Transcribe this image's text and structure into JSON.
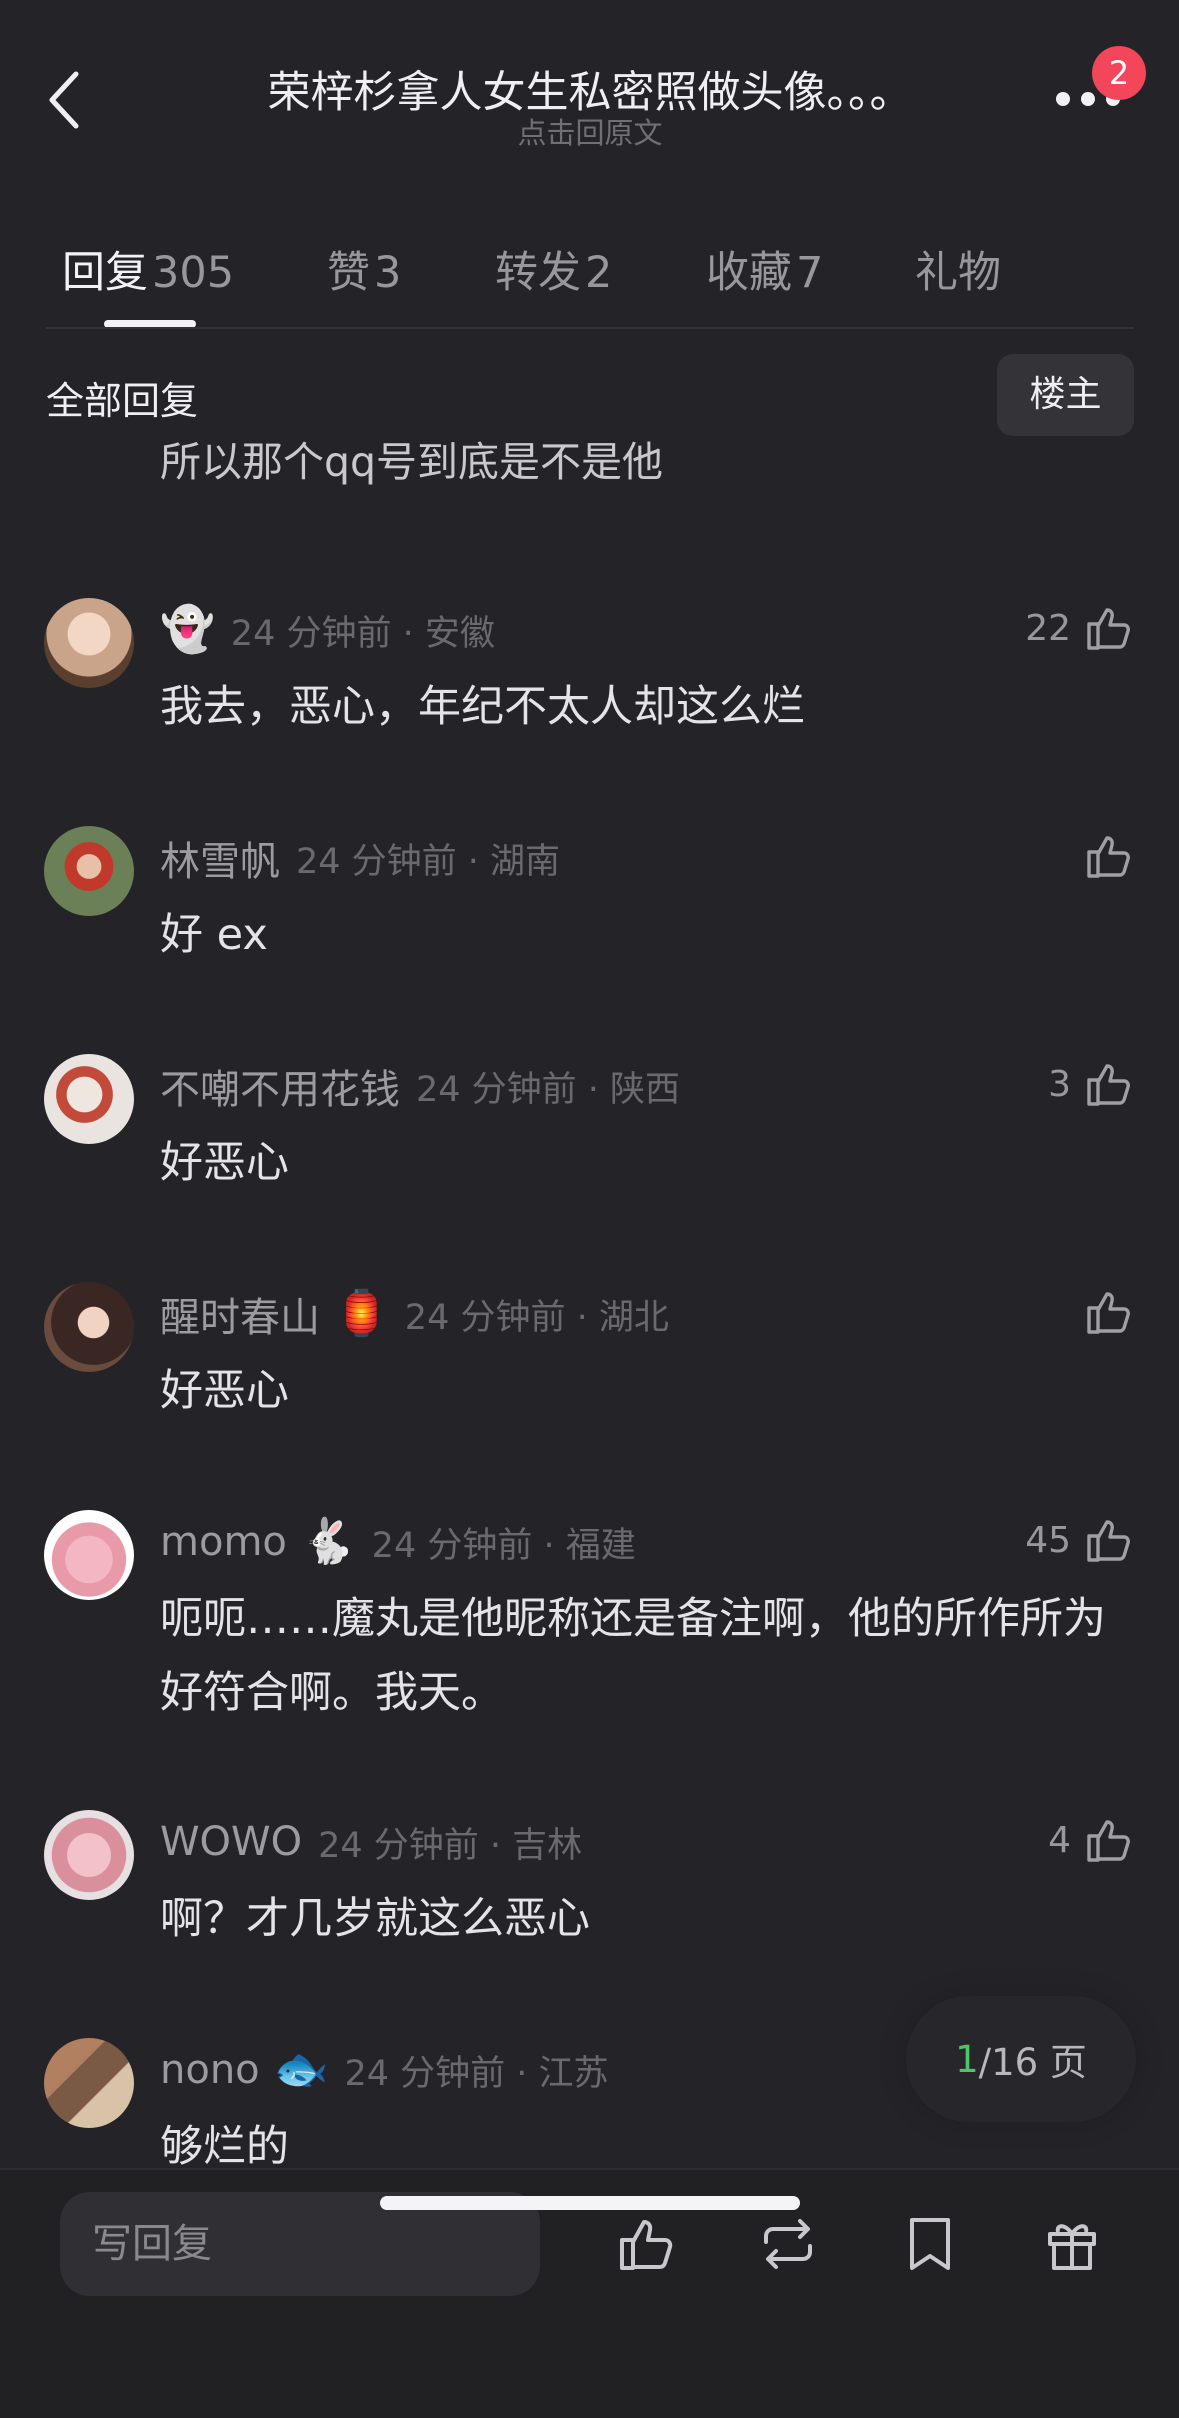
{
  "header": {
    "title": "荣梓杉拿人女生私密照做头像。。。",
    "subtitle": "点击回原文",
    "badge": "2"
  },
  "tabs": [
    {
      "label": "回复",
      "count": "305"
    },
    {
      "label": "赞",
      "count": "3"
    },
    {
      "label": "转发",
      "count": "2"
    },
    {
      "label": "收藏",
      "count": "7"
    },
    {
      "label": "礼物",
      "count": ""
    }
  ],
  "section": {
    "title": "全部回复",
    "owner_button": "楼主"
  },
  "cutoff_text": "所以那个qq号到底是不是他",
  "comments": [
    {
      "user": "",
      "emoji": "👻",
      "time": "24 分钟前 · 安徽",
      "likes": "22",
      "text": "我去，恶心，年纪不太人却这么烂",
      "avatar_color": "#c9a38a"
    },
    {
      "user": "林雪帆",
      "emoji": "",
      "time": "24 分钟前 · 湖南",
      "likes": "",
      "text": "好 ex",
      "avatar_color": "#5b6b4a"
    },
    {
      "user": "不嘲不用花钱",
      "emoji": "",
      "time": "24 分钟前 · 陕西",
      "likes": "3",
      "text": "好恶心",
      "avatar_color": "#d8d2cc"
    },
    {
      "user": "醒时春山",
      "emoji": "🏮",
      "time": "24 分钟前 · 湖北",
      "likes": "",
      "text": "好恶心",
      "avatar_color": "#4a3a36"
    },
    {
      "user": "momo",
      "emoji": "🐇",
      "time": "24 分钟前 · 福建",
      "likes": "45",
      "text": "呃呃……魔丸是他昵称还是备注啊，他的所作所为好符合啊。我天。",
      "avatar_color": "#e8a8b4"
    },
    {
      "user": "WOWO",
      "emoji": "",
      "time": "24 分钟前 · 吉林",
      "likes": "4",
      "text": "啊？才几岁就这么恶心",
      "avatar_color": "#d99aa6"
    },
    {
      "user": "nono",
      "emoji": "🐟",
      "time": "24 分钟前 · 江苏",
      "likes": "",
      "text": "够烂的",
      "avatar_color": "#8a6a52"
    }
  ],
  "pager": {
    "current": "1",
    "total": "/16 页"
  },
  "bottom_bar": {
    "reply_placeholder": "写回复",
    "icons": [
      "like-icon",
      "repost-icon",
      "bookmark-icon",
      "gift-icon"
    ]
  }
}
